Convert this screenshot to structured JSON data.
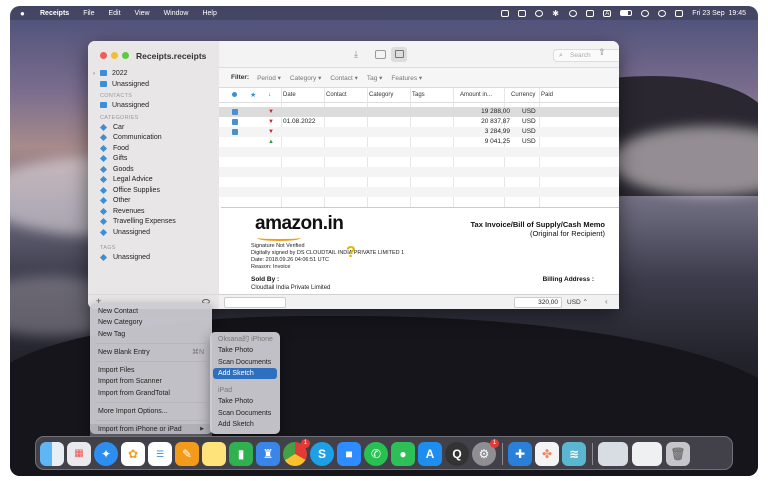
{
  "menubar": {
    "app_name": "Receipts",
    "items": [
      "File",
      "Edit",
      "View",
      "Window",
      "Help"
    ],
    "clock": "Fri 23 Sep  19:45"
  },
  "window": {
    "title": "Receipts.receipts",
    "search_placeholder": "Search"
  },
  "sidebar": {
    "years": [
      {
        "label": "2022"
      },
      {
        "label": "Unassigned"
      }
    ],
    "contacts_header": "CONTACTS",
    "contacts": [
      {
        "label": "Unassigned"
      }
    ],
    "categories_header": "CATEGORIES",
    "categories": [
      {
        "label": "Car"
      },
      {
        "label": "Communication"
      },
      {
        "label": "Food"
      },
      {
        "label": "Gifts"
      },
      {
        "label": "Goods"
      },
      {
        "label": "Legal Advice"
      },
      {
        "label": "Office Supplies"
      },
      {
        "label": "Other"
      },
      {
        "label": "Revenues"
      },
      {
        "label": "Travelling Expenses"
      },
      {
        "label": "Unassigned"
      }
    ],
    "tags_header": "TAGS",
    "tags": [
      {
        "label": "Unassigned"
      }
    ]
  },
  "filterbar": {
    "label": "Filter:",
    "items": [
      "Period ▾",
      "Category ▾",
      "Contact ▾",
      "Tag ▾",
      "Features ▾"
    ]
  },
  "table": {
    "headers": {
      "date": "Date",
      "contact": "Contact",
      "category": "Category",
      "tags": "Tags",
      "amount": "Amount in...",
      "currency": "Currency",
      "paid": "Paid"
    },
    "rows": [
      {
        "date": "",
        "amount": "19 288,00",
        "currency": "USD",
        "flag": "red"
      },
      {
        "date": "01.08.2022",
        "amount": "20 837,87",
        "currency": "USD",
        "flag": "red"
      },
      {
        "date": "",
        "amount": "3 284,99",
        "currency": "USD",
        "flag": "red"
      },
      {
        "date": "",
        "amount": "9 041,25",
        "currency": "USD",
        "flag": "green"
      }
    ]
  },
  "preview": {
    "logo": "amazon.in",
    "title": "Tax Invoice/Bill of Supply/Cash Memo",
    "subtitle": "(Original for Recipient)",
    "sig1": "Signature Not Verified",
    "sig2": "Digitally signed by DS CLOUDTAIL INDIA PRIVATE LIMITED 1",
    "sig3": "Date: 2018.09.26 04:06:51 UTC",
    "sig4": "Reason: Invoice",
    "sold_by": "Sold By :",
    "seller": "Cloudtail India Private Limited",
    "billing": "Billing Address :"
  },
  "bottombar": {
    "amount": "320,00",
    "currency": "USD ⌃"
  },
  "context_menu": {
    "items": [
      {
        "label": "New Contact"
      },
      {
        "label": "New Category"
      },
      {
        "label": "New Tag"
      },
      {
        "label": "New Blank Entry",
        "shortcut": "⌘N"
      },
      {
        "label": "Import Files"
      },
      {
        "label": "Import from Scanner"
      },
      {
        "label": "Import from GrandTotal"
      },
      {
        "label": "More Import Options..."
      },
      {
        "label": "Import from iPhone or iPad",
        "arrow": "▶"
      }
    ]
  },
  "submenu": {
    "iphone_header": "Oksana的 iPhone",
    "iphone_items": [
      "Take Photo",
      "Scan Documents",
      "Add Sketch"
    ],
    "ipad_header": "iPad",
    "ipad_items": [
      "Take Photo",
      "Scan Documents",
      "Add Sketch"
    ]
  },
  "dock": {
    "icons": [
      "finder-icon",
      "launchpad-icon",
      "safari-icon",
      "photos-icon",
      "reminders-icon",
      "pages-icon",
      "notes-icon",
      "numbers-icon",
      "keynote-icon",
      "chrome-icon",
      "skype-icon",
      "zoom-icon",
      "whatsapp-icon",
      "wechat-icon",
      "app-store-icon",
      "quicktime-icon",
      "system-preferences-icon",
      "receipts-app-icon",
      "nimbus-icon",
      "stack-icon",
      "downloads-icon",
      "receipts-doc-icon",
      "trash-icon"
    ],
    "chrome_badge": "1",
    "settings_badge": "1"
  }
}
